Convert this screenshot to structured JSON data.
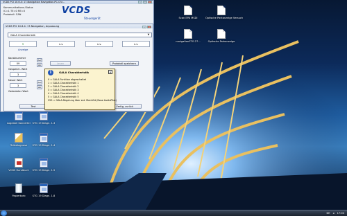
{
  "main_window": {
    "title": "VCDS PCI 10.6.4: 17-Navigation   Navigation-PC-Chr...",
    "status_lines": [
      "Kommunikations-Status",
      "IC=1  TE=0  RE=0",
      "Protokoll: CAN"
    ],
    "logo": "VCDS",
    "subtitle": "Steuergerät"
  },
  "sub_window": {
    "title": "VCDS PCI 10.6.4: 17-Navigation, Anpassung",
    "channel_select": "GALA Charakteristik",
    "measurements": [
      "9",
      "n.v.",
      "n.v.",
      "n.v."
    ],
    "anzeige_label": "Anzeige",
    "kanalnummer_label": "Kanalnummer",
    "kanalnummer_value": "09",
    "lesen_label": "Lesen",
    "protokoll_label": "Protokoll speichern",
    "gespeicherter_label": "Gespeich. Wert",
    "gespeicherter_value": "3",
    "neuer_wert_label": "Neuer Wert",
    "neuer_wert_value": "3",
    "getesteter_label": "Getesteter Wert",
    "auf_label": "Auf",
    "ab_label": "Ab",
    "test_label": "Test",
    "speichern_label": "Speichern",
    "fertig_label": "Fertig, zurück"
  },
  "popup": {
    "title": "GALA Charakteristik",
    "lines": [
      "0 = GALA Funktion abgeschaltet",
      "1 = GALA Charakteristik 1",
      "2 = GALA Charakteristik 2",
      "3 = GALA Charakteristik 3",
      "4 = GALA Charakteristik 4",
      "5 = GALA Charakteristik 5",
      "255 = GALA-Regelung über ext. Menüfkt (Bose AudioPilot)"
    ]
  },
  "desktop_icons": [
    {
      "label": "Scan EPA MSDI",
      "icon": "document-icon"
    },
    {
      "label": "Optische Parkanzeige Versuch",
      "icon": "document-icon"
    },
    {
      "label": "navigationSTG.27...",
      "icon": "document-icon"
    },
    {
      "label": "Optische Parkanzeige",
      "icon": "document-icon"
    },
    {
      "label": "Logdatei Konverter",
      "icon": "app-icon"
    },
    {
      "label": "STG 19 Diagn. 1.3",
      "icon": "app-icon"
    },
    {
      "label": "Teilediagnose",
      "icon": "config-icon"
    },
    {
      "label": "STG 19 Diagn. 1.4",
      "icon": "app-icon"
    },
    {
      "label": "VCDS Handbuch",
      "icon": "pdf-icon"
    },
    {
      "label": "STG 19 Diagn. 1.5",
      "icon": "app-icon"
    },
    {
      "label": "Papierkorb",
      "icon": "recycle-bin-icon"
    },
    {
      "label": "STG 19 Diagn. 1.8",
      "icon": "app-icon"
    }
  ],
  "taskbar": {
    "lang": "DE",
    "time": "17:04"
  }
}
